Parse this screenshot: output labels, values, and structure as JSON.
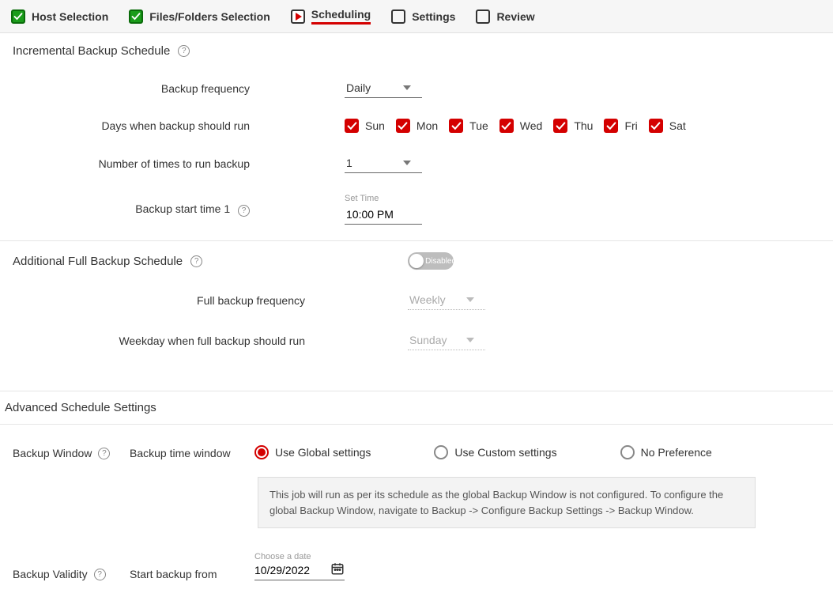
{
  "stepper": {
    "steps": [
      {
        "label": "Host Selection",
        "state": "done"
      },
      {
        "label": "Files/Folders Selection",
        "state": "done"
      },
      {
        "label": "Scheduling",
        "state": "current"
      },
      {
        "label": "Settings",
        "state": "pending"
      },
      {
        "label": "Review",
        "state": "pending"
      }
    ]
  },
  "incremental": {
    "title": "Incremental Backup Schedule",
    "freq_label": "Backup frequency",
    "freq_value": "Daily",
    "days_label": "Days when backup should run",
    "days": [
      "Sun",
      "Mon",
      "Tue",
      "Wed",
      "Thu",
      "Fri",
      "Sat"
    ],
    "times_label": "Number of times to run backup",
    "times_value": "1",
    "start_time_label": "Backup start time 1",
    "set_time_caption": "Set Time",
    "start_time_value": "10:00 PM"
  },
  "full": {
    "title": "Additional Full Backup Schedule",
    "toggle_text": "Disabled",
    "freq_label": "Full backup frequency",
    "freq_value": "Weekly",
    "weekday_label": "Weekday when full backup should run",
    "weekday_value": "Sunday"
  },
  "advanced": {
    "title": "Advanced Schedule Settings",
    "window_label": "Backup Window",
    "time_window_label": "Backup time window",
    "radios": {
      "global": "Use Global settings",
      "custom": "Use Custom settings",
      "none": "No Preference"
    },
    "info_text": "This job will run as per its schedule as the global Backup Window is not configured. To configure the global Backup Window, navigate to Backup -> Configure Backup Settings -> Backup Window.",
    "validity_label": "Backup Validity",
    "start_from_label": "Start backup from",
    "date_caption": "Choose a date",
    "date_value": "10/29/2022"
  }
}
